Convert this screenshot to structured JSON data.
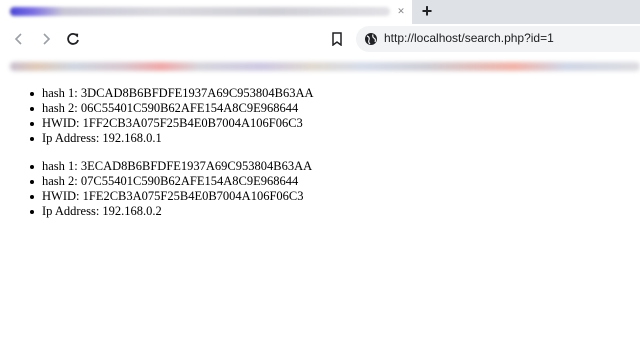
{
  "browser": {
    "tab_close_glyph": "✕",
    "new_tab_glyph": "+",
    "url": "http://localhost/search.php?id=1",
    "icons": {
      "back": "back-arrow-icon",
      "forward": "forward-arrow-icon",
      "reload": "reload-icon",
      "bookmark": "bookmark-icon",
      "site_info": "globe-icon"
    }
  },
  "records": [
    {
      "hash1_label": "hash 1:",
      "hash1_value": "3DCAD8B6BFDFE1937A69C953804B63AA",
      "hash2_label": "hash 2:",
      "hash2_value": "06C55401C590B62AFE154A8C9E968644",
      "hwid_label": "HWID:",
      "hwid_value": "1FF2CB3A075F25B4E0B7004A106F06C3",
      "ip_label": "Ip Address:",
      "ip_value": "192.168.0.1"
    },
    {
      "hash1_label": "hash 1:",
      "hash1_value": "3ECAD8B6BFDFE1937A69C953804B63AA",
      "hash2_label": "hash 2:",
      "hash2_value": "07C55401C590B62AFE154A8C9E968644",
      "hwid_label": "HWID:",
      "hwid_value": "1FE2CB3A075F25B4E0B7004A106F06C3",
      "ip_label": "Ip Address:",
      "ip_value": "192.168.0.2"
    }
  ]
}
